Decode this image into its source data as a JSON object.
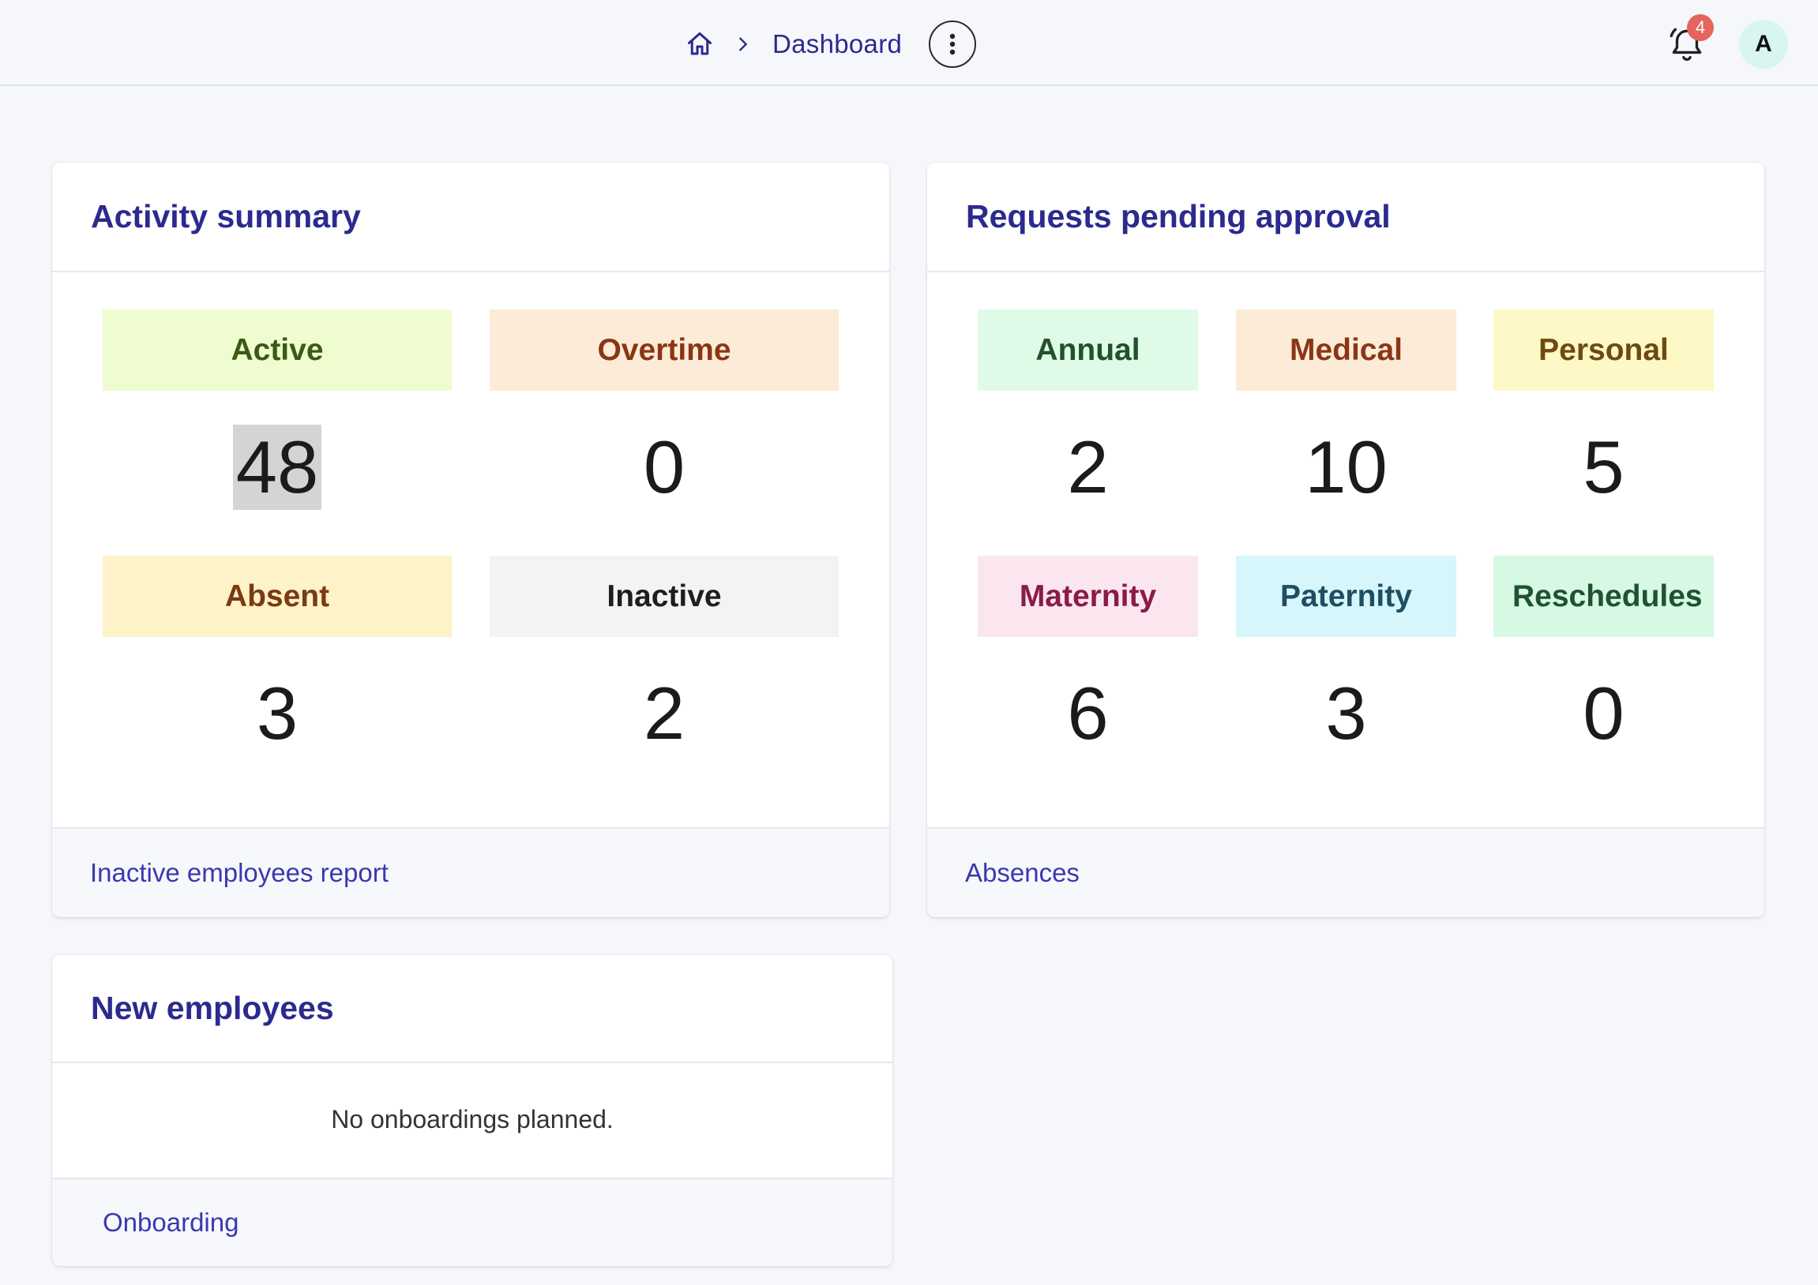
{
  "topbar": {
    "breadcrumb": {
      "home_icon": "home-icon",
      "separator_icon": "chevron-right-icon",
      "current": "Dashboard"
    },
    "more_icon": "vertical-dots-icon",
    "notifications": {
      "icon": "bell-icon",
      "count": "4"
    },
    "avatar_initial": "A"
  },
  "activity_summary": {
    "title": "Activity summary",
    "tiles": [
      {
        "label": "Active",
        "value": "48",
        "bg": "#eefcd0",
        "fg": "#3b5a13"
      },
      {
        "label": "Overtime",
        "value": "0",
        "bg": "#fcebd7",
        "fg": "#8a3615"
      },
      {
        "label": "Absent",
        "value": "3",
        "bg": "#fdf2c8",
        "fg": "#7a3a12"
      },
      {
        "label": "Inactive",
        "value": "2",
        "bg": "#f3f3f4",
        "fg": "#1e1e1e"
      }
    ],
    "footer_link": "Inactive employees report"
  },
  "requests_pending": {
    "title": "Requests pending approval",
    "tiles": [
      {
        "label": "Annual",
        "value": "2",
        "bg": "#dffbe7",
        "fg": "#22512b"
      },
      {
        "label": "Medical",
        "value": "10",
        "bg": "#fcebd7",
        "fg": "#8a3615"
      },
      {
        "label": "Personal",
        "value": "5",
        "bg": "#fdf8c5",
        "fg": "#6e4a12"
      },
      {
        "label": "Maternity",
        "value": "6",
        "bg": "#fbe6ef",
        "fg": "#8a1c45"
      },
      {
        "label": "Paternity",
        "value": "3",
        "bg": "#d6f6fb",
        "fg": "#1e4e63"
      },
      {
        "label": "Reschedules",
        "value": "0",
        "bg": "#d7f8e3",
        "fg": "#1f5233"
      }
    ],
    "footer_link": "Absences"
  },
  "new_employees": {
    "title": "New employees",
    "empty_message": "No onboardings planned.",
    "footer_link": "Onboarding"
  }
}
